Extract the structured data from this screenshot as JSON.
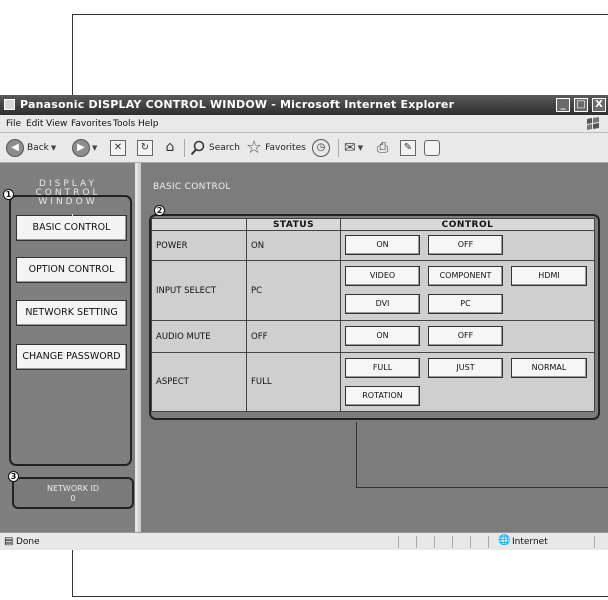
{
  "window": {
    "title": "Panasonic DISPLAY CONTROL WINDOW - Microsoft Internet Explorer",
    "controls": [
      "_",
      "□",
      "X"
    ]
  },
  "menubar": {
    "items": [
      "File",
      "Edit",
      "View",
      "Favorites",
      "Tools",
      "Help"
    ]
  },
  "toolbar": {
    "back_label": "Back",
    "search_label": "Search",
    "favorites_label": "Favorites"
  },
  "sidebar": {
    "title_lines": [
      "DISPLAY",
      "CONTROL",
      "WINDOW"
    ],
    "marker": "1",
    "items": [
      {
        "label": "BASIC CONTROL"
      },
      {
        "label": "OPTION CONTROL"
      },
      {
        "label": "NETWORK SETTING"
      },
      {
        "label": "CHANGE PASSWORD"
      }
    ],
    "network_marker": "3",
    "network_id_label": "NETWORK ID",
    "network_id_value": "0"
  },
  "main": {
    "heading": "BASIC CONTROL",
    "marker": "2",
    "columns": {
      "status": "STATUS",
      "control": "CONTROL"
    },
    "rows": [
      {
        "label": "POWER",
        "status": "ON",
        "buttons": [
          "ON",
          "OFF"
        ]
      },
      {
        "label": "INPUT SELECT",
        "status": "PC",
        "buttons": [
          "VIDEO",
          "COMPONENT",
          "HDMI",
          "DVI",
          "PC"
        ]
      },
      {
        "label": "AUDIO MUTE",
        "status": "OFF",
        "buttons": [
          "ON",
          "OFF"
        ]
      },
      {
        "label": "ASPECT",
        "status": "FULL",
        "buttons": [
          "FULL",
          "JUST",
          "NORMAL",
          "ROTATION"
        ]
      }
    ]
  },
  "statusbar": {
    "left": "Done",
    "zone": "Internet"
  }
}
